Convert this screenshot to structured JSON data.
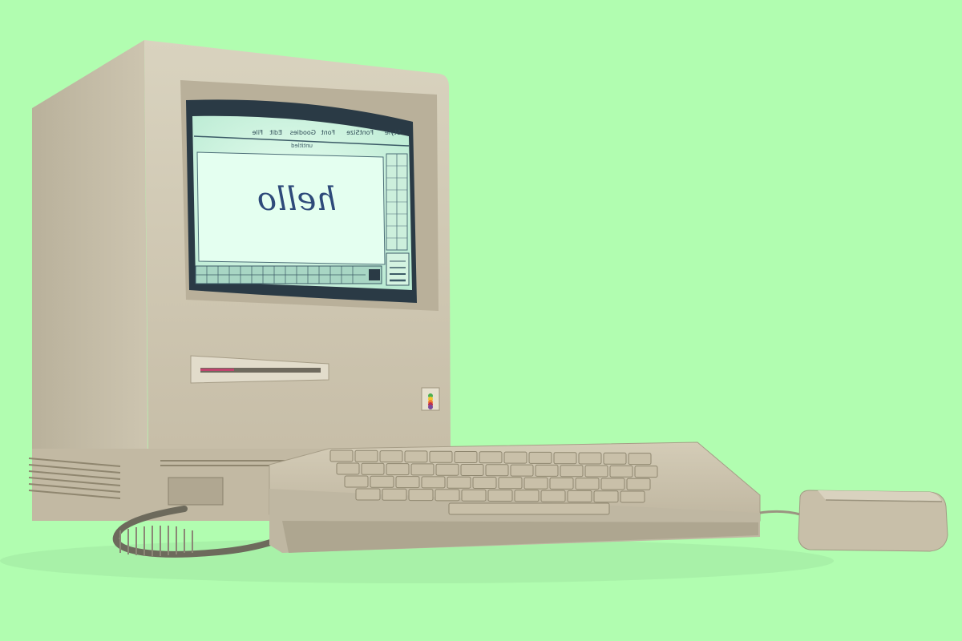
{
  "background_color": "#b1fdb0",
  "screen": {
    "menu_items": [
      "Style",
      "FontSize",
      "Font",
      "Goodies",
      "Edit",
      "File"
    ],
    "window_title": "untitled",
    "drawing_text": "hello"
  },
  "colors": {
    "case": "#cfc7b3",
    "case_shadow": "#a59c86",
    "screen_glow": "#d7fbe6",
    "screen_frame": "#2a3a45",
    "cord": "#6d6a5c"
  },
  "icons": [
    "apple-logo-icon",
    "floppy-slot-icon"
  ]
}
